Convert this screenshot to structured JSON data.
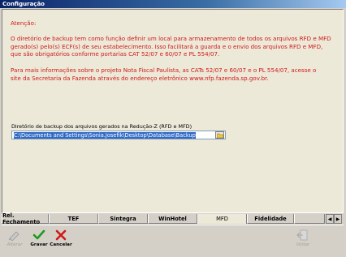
{
  "window": {
    "title": "Configuração"
  },
  "notice": {
    "heading": "Atenção:",
    "p1": [
      "O diretório de backup tem como função definir um local para armazenamento de todos os arquivos RFD e MFD",
      "gerado(s) pelo(s) ECF(s) de seu estabelecimento. Isso facilitará a guarda e o envio dos arquivos RFD e MFD,",
      "que são obrigatórios conforme portarias CAT 52/07 e 60/07 e PL 554/07."
    ],
    "p2": [
      "Para mais informações sobre o projeto Nota Fiscal Paulista, as CATs 52/07 e 60/07 e o PL 554/07, acesse o",
      "site da Secretaria da Fazenda através do endereço eletrônico www.nfp.fazenda.sp.gov.br."
    ]
  },
  "backup": {
    "label": "Diretório de backup dos arquivos gerados na Redução-Z (RFD e MFD)",
    "value": "C:\\Documents and Settings\\Sonia.Josefik\\Desktop\\Database\\Backup"
  },
  "tabs": [
    "Rel. Fechamento",
    "TEF",
    "Sintegra",
    "WinHotel",
    "MFD",
    "Fidelidade"
  ],
  "active_tab": "MFD",
  "toolbar": {
    "alterar": "Alterar",
    "gravar": "Gravar",
    "cancelar": "Cancelar",
    "voltar": "Voltar"
  }
}
